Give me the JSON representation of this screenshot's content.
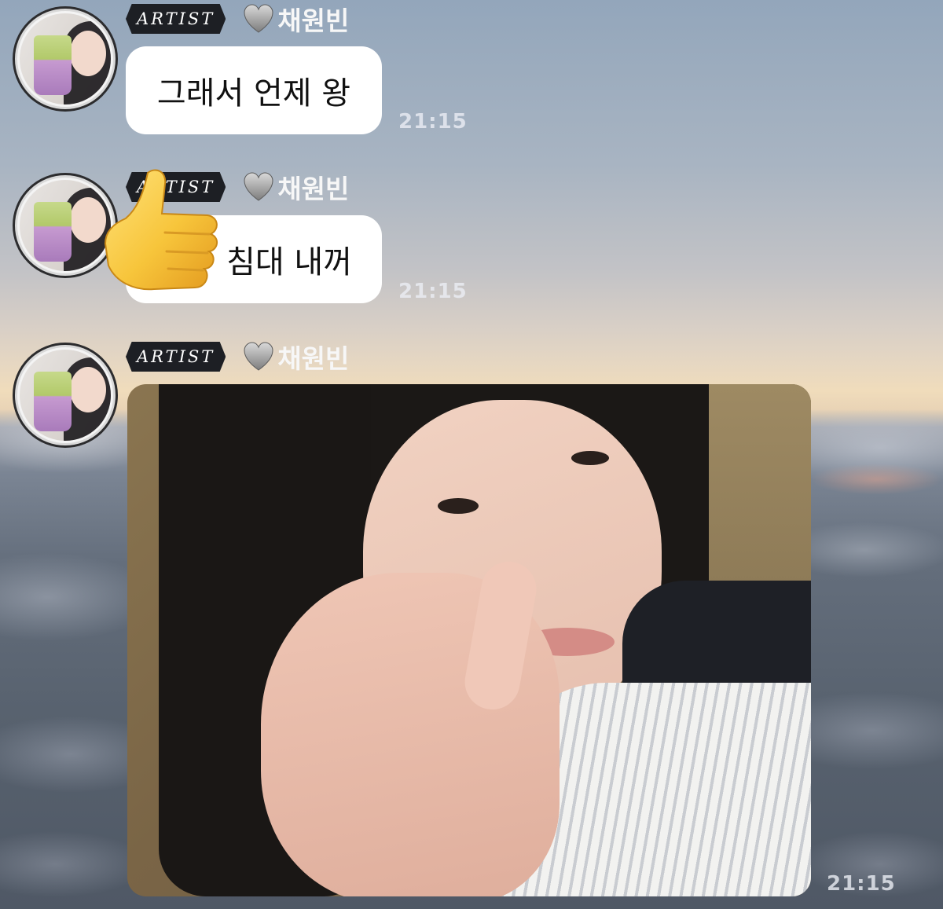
{
  "messages": [
    {
      "badge": "ARTIST",
      "sender": "채원빈",
      "text": "그래서 언제 왕",
      "time": "21:15"
    },
    {
      "badge": "ARTIST",
      "sender": "채원빈",
      "text": "침대 내꺼",
      "time": "21:15",
      "emoji": "thumbs-up-icon"
    },
    {
      "badge": "ARTIST",
      "sender": "채원빈",
      "attachment": "photo",
      "time": "21:15"
    }
  ],
  "colors": {
    "bubble": "#ffffff",
    "badge_bg": "#1d1f24",
    "name_text": "#f7f7f7"
  }
}
